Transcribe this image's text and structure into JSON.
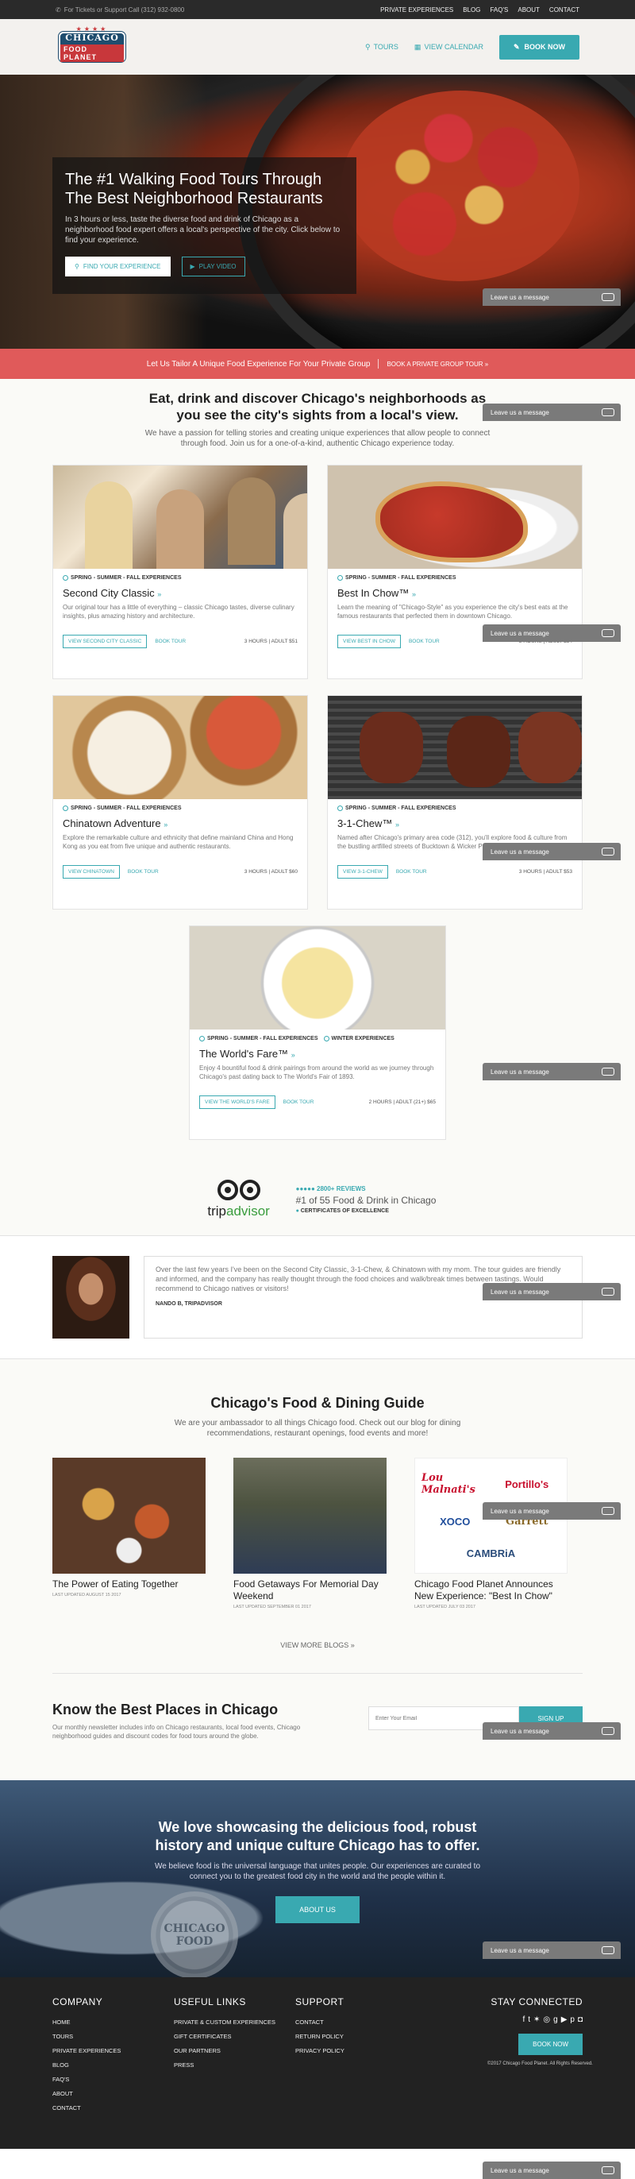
{
  "topbar": {
    "phone": "For Tickets or Support Call (312) 932-0800",
    "links": [
      "PRIVATE EXPERIENCES",
      "BLOG",
      "FAQ'S",
      "ABOUT",
      "CONTACT"
    ]
  },
  "header": {
    "logo_line1": "CHICAGO",
    "logo_line2": "FOOD PLANET",
    "nav": [
      "TOURS",
      "VIEW CALENDAR"
    ],
    "book_now": "BOOK NOW"
  },
  "hero": {
    "title": "The #1 Walking Food Tours Through The Best Neighborhood Restaurants",
    "text": "In 3 hours or less, taste the diverse food and drink of Chicago as a neighborhood food expert offers a local's perspective of the city. Click below to find your experience.",
    "btn_find": "FIND YOUR EXPERIENCE",
    "btn_video": "PLAY VIDEO"
  },
  "redbar": {
    "text": "Let Us Tailor A Unique Food Experience For Your Private Group",
    "cta": "BOOK A PRIVATE GROUP TOUR »"
  },
  "intro": {
    "title": "Eat, drink and discover Chicago's neighborhoods as you see the city's sights from a local's view.",
    "text": "We have a passion for telling stories and creating unique experiences that allow people to connect through food. Join us for a one-of-a-kind, authentic Chicago experience today."
  },
  "tours": [
    {
      "seasons": "SPRING - SUMMER - FALL EXPERIENCES",
      "title": "Second City Classic",
      "desc": "Our original tour has a little of everything – classic Chicago tastes, diverse culinary insights, plus amazing history and architecture.",
      "view": "VIEW SECOND CITY CLASSIC",
      "book": "BOOK TOUR",
      "meta": "3 HOURS | ADULT $51"
    },
    {
      "seasons": "SPRING - SUMMER - FALL EXPERIENCES",
      "title": "Best In Chow™",
      "desc": "Learn the meaning of \"Chicago-Style\" as you experience the city's best eats at the famous restaurants that perfected them in downtown Chicago.",
      "view": "VIEW BEST IN CHOW",
      "book": "BOOK TOUR",
      "meta": "3 HOURS | ADULT $54"
    },
    {
      "seasons": "SPRING - SUMMER - FALL EXPERIENCES",
      "title": "Chinatown Adventure",
      "desc": "Explore the remarkable culture and ethnicity that define mainland China and Hong Kong as you eat from five unique and authentic restaurants.",
      "view": "VIEW CHINATOWN",
      "book": "BOOK TOUR",
      "meta": "3 HOURS | ADULT $60"
    },
    {
      "seasons": "SPRING - SUMMER - FALL EXPERIENCES",
      "title": "3-1-Chew™",
      "desc": "Named after Chicago's primary area code (312), you'll explore food & culture from the bustling artfilled streets of Bucktown & Wicker Park.",
      "view": "VIEW 3-1-CHEW",
      "book": "BOOK TOUR",
      "meta": "3 HOURS | ADULT $53"
    },
    {
      "seasons": "SPRING - SUMMER - FALL EXPERIENCES",
      "seasons2": "WINTER EXPERIENCES",
      "title": "The World's Fare™",
      "desc": "Enjoy 4 bountiful food & drink pairings from around the world as we journey through Chicago's past dating back to The World's Fair of 1893.",
      "view": "VIEW THE WORLD'S FARE",
      "book": "BOOK TOUR",
      "meta": "2 HOURS | ADULT (21+) $65"
    }
  ],
  "tripadvisor": {
    "word_a": "trip",
    "word_b": "advisor",
    "reviews": "2800+ REVIEWS",
    "rank": "#1 of 55 Food & Drink in Chicago",
    "cert": "CERTIFICATES OF EXCELLENCE"
  },
  "testimonial": {
    "text": "Over the last few years I've been on the Second City Classic, 3-1-Chew, & Chinatown with my mom. The tour guides are friendly and informed, and the company has really thought through the food choices and walk/break times between tastings. Would recommend to Chicago natives or visitors!",
    "author": "NANDO B, TRIPADVISOR"
  },
  "blog": {
    "title": "Chicago's Food & Dining Guide",
    "sub": "We are your ambassador to all things Chicago food. Check out our blog for dining recommendations, restaurant openings, food events and more!",
    "posts": [
      {
        "title": "The Power of Eating Together",
        "date": "LAST UPDATED AUGUST 15 2017"
      },
      {
        "title": "Food Getaways For Memorial Day Weekend",
        "date": "LAST UPDATED SEPTEMBER 01 2017"
      },
      {
        "title": "Chicago Food Planet Announces New Experience: \"Best In Chow\"",
        "date": "LAST UPDATED JULY 03 2017"
      }
    ],
    "logos": [
      "Lou Malnati's",
      "Portillo's",
      "XOCO",
      "Garrett",
      "CAMBRiA"
    ],
    "view_more": "VIEW MORE BLOGS »"
  },
  "newsletter": {
    "title": "Know the Best Places in Chicago",
    "text": "Our monthly newsletter includes info on Chicago restaurants, local food events, Chicago neighborhood guides and discount codes for food tours around the globe.",
    "placeholder": "Enter Your Email",
    "button": "SIGN UP"
  },
  "showcase": {
    "title": "We love showcasing the delicious food, robust history and unique culture Chicago has to offer.",
    "text": "We believe food is the universal language that unites people. Our experiences are curated to connect you to the greatest food city in the world and the people within it.",
    "pin_line1": "CHICAGO",
    "pin_line2": "FOOD",
    "button": "ABOUT US"
  },
  "footer": {
    "company": {
      "title": "COMPANY",
      "items": [
        "HOME",
        "TOURS",
        "PRIVATE EXPERIENCES",
        "BLOG",
        "FAQ'S",
        "ABOUT",
        "CONTACT"
      ]
    },
    "useful": {
      "title": "USEFUL LINKS",
      "items": [
        "PRIVATE & CUSTOM EXPERIENCES",
        "GIFT CERTIFICATES",
        "OUR PARTNERS",
        "PRESS"
      ]
    },
    "support": {
      "title": "SUPPORT",
      "items": [
        "CONTACT",
        "RETURN POLICY",
        "PRIVACY POLICY"
      ]
    },
    "stay": {
      "title": "STAY CONNECTED",
      "book": "BOOK NOW",
      "copy": "©2017 Chicago Food Planet. All Rights Reserved."
    }
  },
  "chat": {
    "label": "Leave us a message"
  },
  "colors": {
    "accent": "#39a9b1",
    "red_banner": "#e05a5a",
    "dark": "#2a2a2a"
  }
}
